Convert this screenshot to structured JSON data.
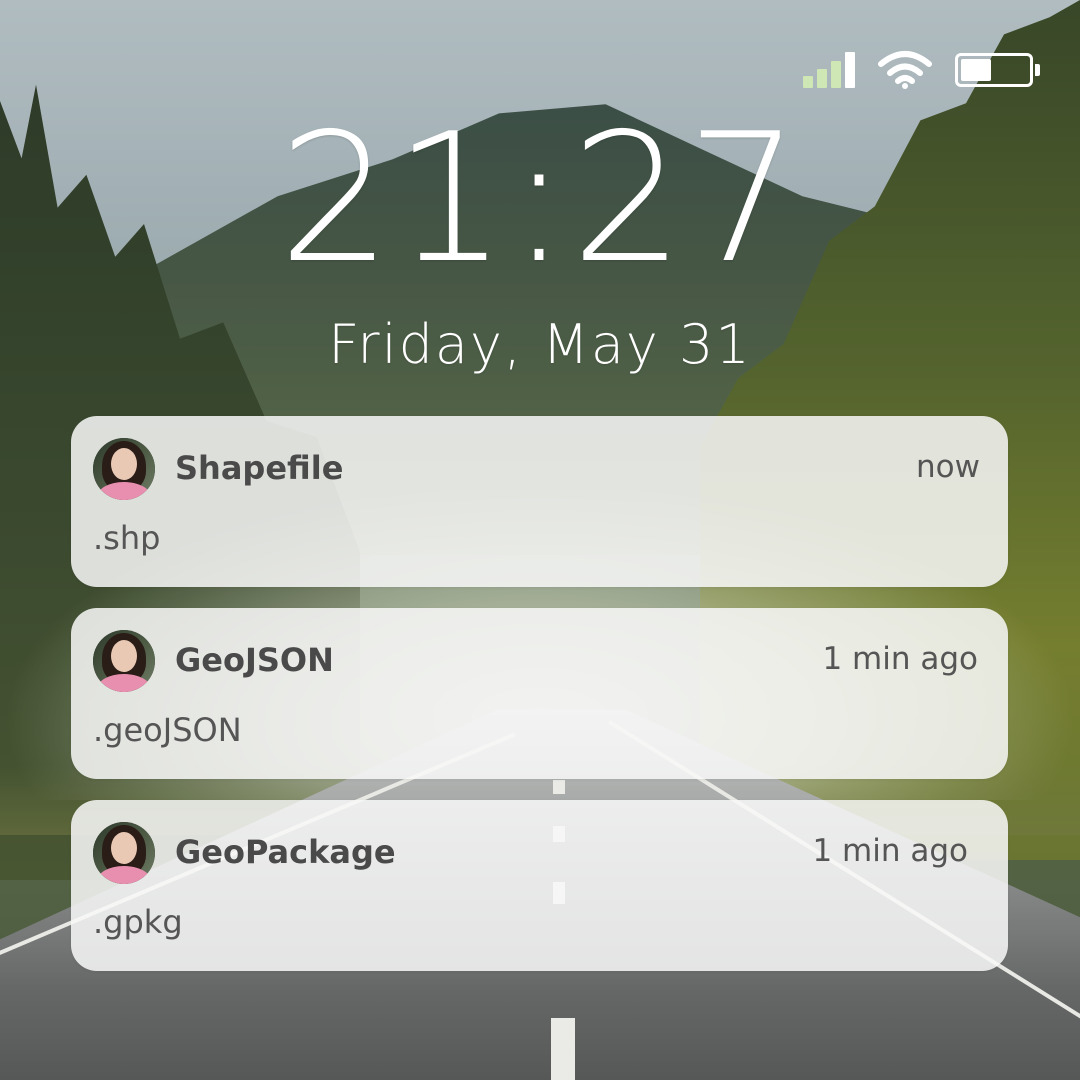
{
  "status_bar": {
    "signal_icon": "cellular-signal-icon",
    "signal_colors": [
      "#cfe6b5",
      "#cfe6b5",
      "#cfe6b5",
      "#ffffff"
    ],
    "wifi_icon": "wifi-icon",
    "battery_icon": "battery-icon",
    "battery_level": 0.45
  },
  "lock_screen": {
    "time": "21:27",
    "date": "Friday, May 31"
  },
  "notifications": [
    {
      "app": "Shapefile",
      "time": "now",
      "body": ".shp"
    },
    {
      "app": "GeoJSON",
      "time": "1 min ago",
      "body": ".geoJSON"
    },
    {
      "app": "GeoPackage",
      "time": "1 min ago",
      "body": ".gpkg"
    }
  ]
}
